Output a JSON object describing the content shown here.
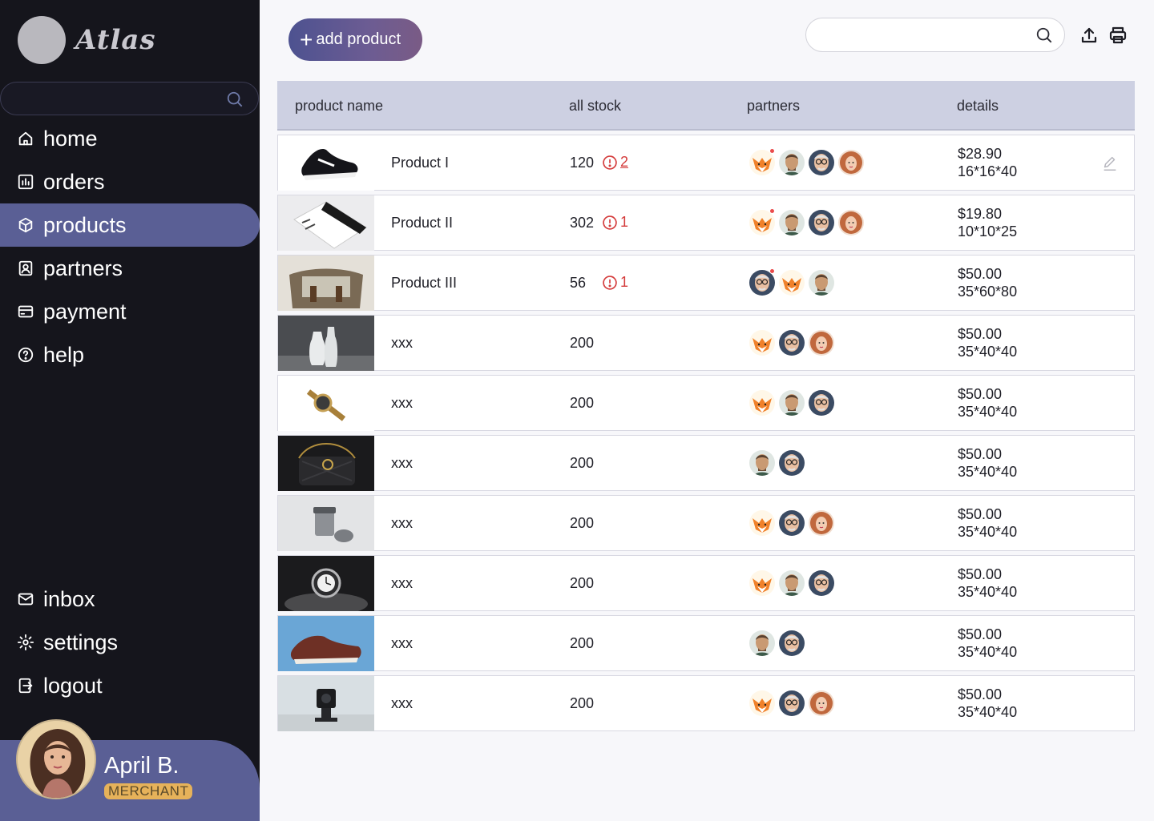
{
  "app": {
    "name": "Atlas"
  },
  "sidebar": {
    "search_placeholder": "",
    "nav_top": [
      {
        "label": "home",
        "icon": "home-icon",
        "active": false
      },
      {
        "label": "orders",
        "icon": "chart-icon",
        "active": false
      },
      {
        "label": "products",
        "icon": "box-icon",
        "active": true
      },
      {
        "label": "partners",
        "icon": "badge-icon",
        "active": false
      },
      {
        "label": "payment",
        "icon": "card-icon",
        "active": false
      },
      {
        "label": "help",
        "icon": "help-icon",
        "active": false
      }
    ],
    "nav_bottom": [
      {
        "label": "inbox",
        "icon": "mail-icon"
      },
      {
        "label": "settings",
        "icon": "gear-icon"
      },
      {
        "label": "logout",
        "icon": "logout-icon"
      }
    ],
    "user": {
      "name": "April B.",
      "role": "MERCHANT"
    }
  },
  "header": {
    "add_label": "add product",
    "search_placeholder": "",
    "icons": [
      "upload-icon",
      "print-icon"
    ]
  },
  "table": {
    "columns": [
      "product name",
      "all stock",
      "partners",
      "details"
    ],
    "rows": [
      {
        "image": "black-sneaker",
        "name": "Product I",
        "stock": "120",
        "alert": "2",
        "alert_underline": true,
        "partners": [
          "fox",
          "man",
          "oldman",
          "redhead"
        ],
        "dot": true,
        "price": "$28.90",
        "dims": "16*16*40",
        "editable": true
      },
      {
        "image": "packaging-box",
        "name": "Product II",
        "stock": "302",
        "alert": "1",
        "alert_underline": false,
        "partners": [
          "fox",
          "man",
          "oldman",
          "redhead"
        ],
        "dot": true,
        "price": "$19.80",
        "dims": "10*10*25",
        "editable": false
      },
      {
        "image": "canvas-bag",
        "name": "Product III",
        "stock": "56",
        "alert": "1",
        "alert_underline": false,
        "partners": [
          "oldman",
          "fox",
          "man"
        ],
        "dot": true,
        "price": "$50.00",
        "dims": "35*60*80",
        "editable": false
      },
      {
        "image": "white-vases",
        "name": "xxx",
        "stock": "200",
        "alert": "",
        "partners": [
          "fox",
          "oldman",
          "redhead"
        ],
        "dot": false,
        "price": "$50.00",
        "dims": "35*40*40",
        "editable": false
      },
      {
        "image": "wristwatch",
        "name": "xxx",
        "stock": "200",
        "alert": "",
        "partners": [
          "fox",
          "man",
          "oldman"
        ],
        "dot": false,
        "price": "$50.00",
        "dims": "35*40*40",
        "editable": false
      },
      {
        "image": "black-handbag",
        "name": "xxx",
        "stock": "200",
        "alert": "",
        "partners": [
          "man",
          "oldman"
        ],
        "dot": false,
        "price": "$50.00",
        "dims": "35*40*40",
        "editable": false
      },
      {
        "image": "silver-jar",
        "name": "xxx",
        "stock": "200",
        "alert": "",
        "partners": [
          "fox",
          "oldman",
          "redhead"
        ],
        "dot": false,
        "price": "$50.00",
        "dims": "35*40*40",
        "editable": false
      },
      {
        "image": "watch-on-stone",
        "name": "xxx",
        "stock": "200",
        "alert": "",
        "partners": [
          "fox",
          "man",
          "oldman"
        ],
        "dot": false,
        "price": "$50.00",
        "dims": "35*40*40",
        "editable": false
      },
      {
        "image": "brown-sneaker",
        "name": "xxx",
        "stock": "200",
        "alert": "",
        "partners": [
          "man",
          "oldman"
        ],
        "dot": false,
        "price": "$50.00",
        "dims": "35*40*40",
        "editable": false
      },
      {
        "image": "action-camera",
        "name": "xxx",
        "stock": "200",
        "alert": "",
        "partners": [
          "fox",
          "oldman",
          "redhead"
        ],
        "dot": false,
        "price": "$50.00",
        "dims": "35*40*40",
        "editable": false
      }
    ]
  },
  "colors": {
    "sidebar_bg": "#15151c",
    "accent": "#5a5f95",
    "header_bg": "#cdd0e2",
    "alert": "#d43b3b",
    "role_badge": "#e6b25a"
  }
}
